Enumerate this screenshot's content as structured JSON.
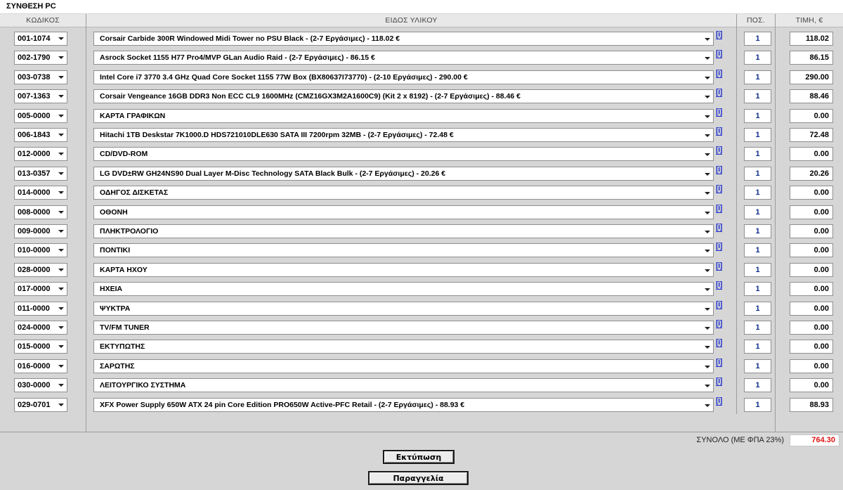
{
  "page_title": "ΣΥΝΘΕΣΗ PC",
  "columns": {
    "code": "ΚΩΔΙΚΟΣ",
    "item": "ΕΙΔΟΣ ΥΛΙΚΟΥ",
    "qty": "ΠΟΣ.",
    "price": "ΤΙΜΗ, €"
  },
  "info_link": "[i]",
  "rows": [
    {
      "code": "001-1074",
      "item": "Corsair Carbide 300R Windowed Midi Tower no PSU Black - (2-7 Εργάσιμες) - 118.02 €",
      "qty": "1",
      "price": "118.02"
    },
    {
      "code": "002-1790",
      "item": "Asrock Socket 1155 H77 Pro4/MVP GLan Audio Raid - (2-7 Εργάσιμες) - 86.15 €",
      "qty": "1",
      "price": "86.15"
    },
    {
      "code": "003-0738",
      "item": "Intel Core i7 3770 3.4 GHz Quad Core Socket 1155 77W Box (BX80637I73770) - (2-10 Εργάσιμες) - 290.00 €",
      "qty": "1",
      "price": "290.00"
    },
    {
      "code": "007-1363",
      "item": "Corsair Vengeance 16GB DDR3 Non ECC CL9 1600MHz (CMZ16GX3M2A1600C9) (Kit 2 x 8192) - (2-7 Εργάσιμες) - 88.46 €",
      "qty": "1",
      "price": "88.46"
    },
    {
      "code": "005-0000",
      "item": "ΚΑΡΤΑ ΓΡΑΦΙΚΩΝ",
      "qty": "1",
      "price": "0.00"
    },
    {
      "code": "006-1843",
      "item": "Hitachi 1TB Deskstar 7K1000.D HDS721010DLE630 SATA III 7200rpm 32MB - (2-7 Εργάσιμες) - 72.48 €",
      "qty": "1",
      "price": "72.48"
    },
    {
      "code": "012-0000",
      "item": "CD/DVD-ROM",
      "qty": "1",
      "price": "0.00"
    },
    {
      "code": "013-0357",
      "item": "LG DVD±RW GH24NS90 Dual Layer M-Disc Technology SATA Black Bulk - (2-7 Εργάσιμες) - 20.26 €",
      "qty": "1",
      "price": "20.26"
    },
    {
      "code": "014-0000",
      "item": "ΟΔΗΓΟΣ ΔΙΣΚΕΤΑΣ",
      "qty": "1",
      "price": "0.00"
    },
    {
      "code": "008-0000",
      "item": "ΟΘΟΝΗ",
      "qty": "1",
      "price": "0.00"
    },
    {
      "code": "009-0000",
      "item": "ΠΛΗΚΤΡΟΛΟΓΙΟ",
      "qty": "1",
      "price": "0.00"
    },
    {
      "code": "010-0000",
      "item": "ΠΟΝΤΙΚΙ",
      "qty": "1",
      "price": "0.00"
    },
    {
      "code": "028-0000",
      "item": "ΚΑΡΤΑ ΗΧΟΥ",
      "qty": "1",
      "price": "0.00"
    },
    {
      "code": "017-0000",
      "item": "ΗΧΕΙΑ",
      "qty": "1",
      "price": "0.00"
    },
    {
      "code": "011-0000",
      "item": "ΨΥΚΤΡΑ",
      "qty": "1",
      "price": "0.00"
    },
    {
      "code": "024-0000",
      "item": "TV/FM TUNER",
      "qty": "1",
      "price": "0.00"
    },
    {
      "code": "015-0000",
      "item": "ΕΚΤΥΠΩΤΗΣ",
      "qty": "1",
      "price": "0.00"
    },
    {
      "code": "016-0000",
      "item": "ΣΑΡΩΤΗΣ",
      "qty": "1",
      "price": "0.00"
    },
    {
      "code": "030-0000",
      "item": "ΛΕΙΤΟΥΡΓΙΚΟ ΣΥΣΤΗΜΑ",
      "qty": "1",
      "price": "0.00"
    },
    {
      "code": "029-0701",
      "item": "XFX Power Supply 650W ATX 24 pin Core Edition PRO650W Active-PFC Retail - (2-7 Εργάσιμες) - 88.93 €",
      "qty": "1",
      "price": "88.93"
    }
  ],
  "total": {
    "label": "ΣΥΝΟΛΟ (ΜΕ ΦΠΑ 23%)",
    "value": "764.30"
  },
  "buttons": {
    "print": "Εκτύπωση",
    "order": "Παραγγελία"
  },
  "colors": {
    "total_value": "#e01515",
    "info_link": "#2233cc",
    "background": "#d6d6d6"
  }
}
